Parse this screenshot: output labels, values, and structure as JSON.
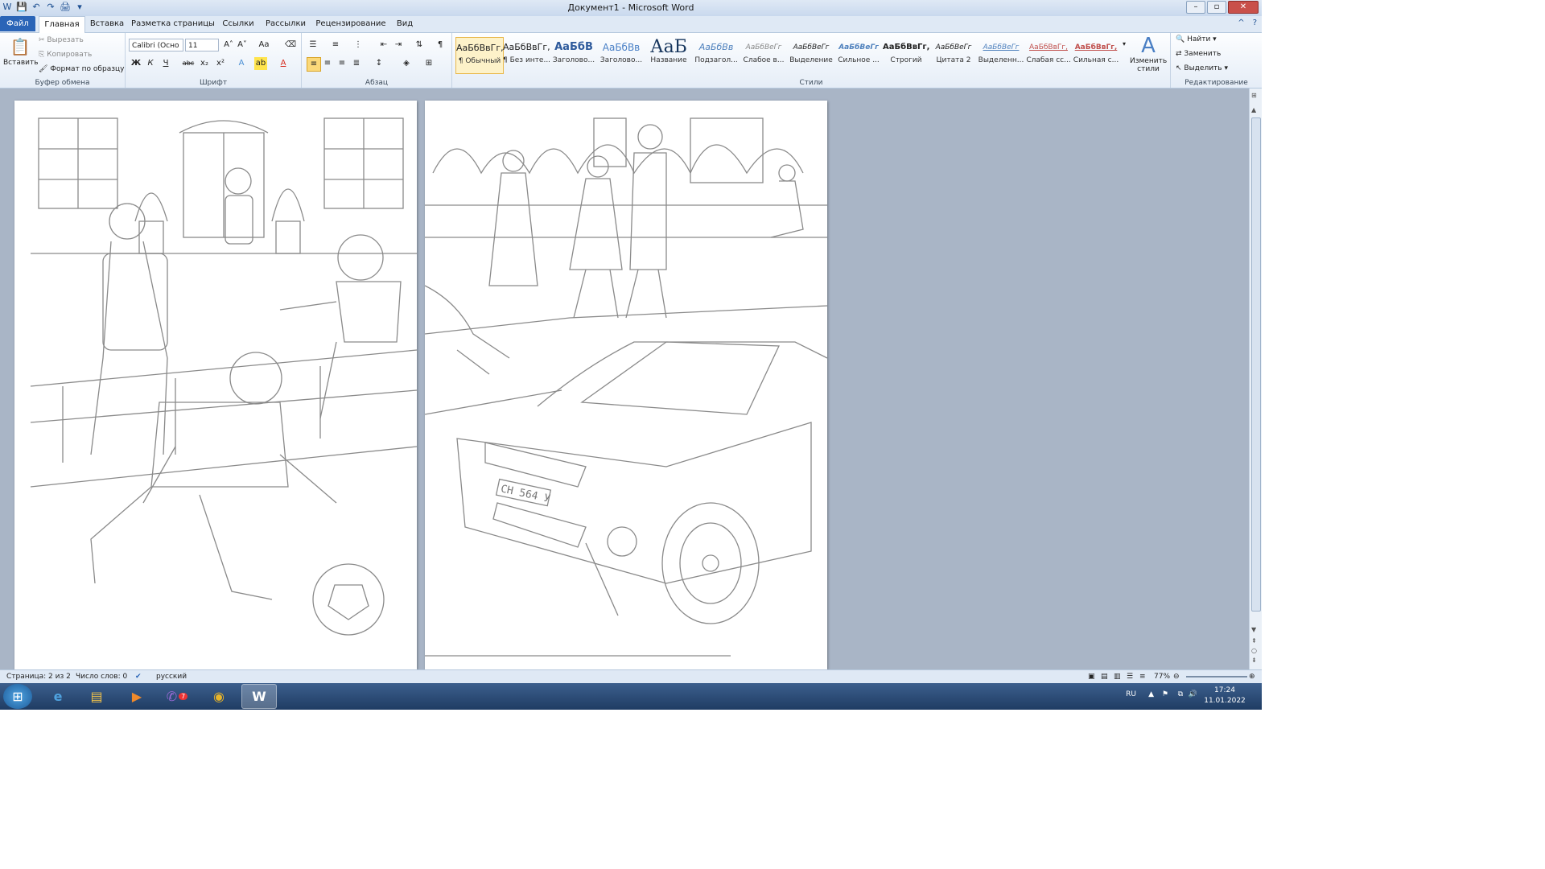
{
  "window": {
    "title": "Документ1 - Microsoft Word"
  },
  "tabs": [
    {
      "label": "Файл"
    },
    {
      "label": "Главная"
    },
    {
      "label": "Вставка"
    },
    {
      "label": "Разметка страницы"
    },
    {
      "label": "Ссылки"
    },
    {
      "label": "Рассылки"
    },
    {
      "label": "Рецензирование"
    },
    {
      "label": "Вид"
    }
  ],
  "clipboard": {
    "paste": "Вставить",
    "cut": "Вырезать",
    "copy": "Копировать",
    "format_painter": "Формат по образцу",
    "group": "Буфер обмена"
  },
  "font": {
    "name": "Calibri (Осно",
    "size": "11",
    "group": "Шрифт",
    "bold": "Ж",
    "italic": "К",
    "underline": "Ч",
    "strike": "abc",
    "sub": "x₂",
    "sup": "x²"
  },
  "paragraph": {
    "group": "Абзац"
  },
  "styles": {
    "group": "Стили",
    "items": [
      {
        "sample": "АаБбВвГг,",
        "name": "¶ Обычный"
      },
      {
        "sample": "АаБбВвГг,",
        "name": "¶ Без инте..."
      },
      {
        "sample": "АаБбВ",
        "name": "Заголово..."
      },
      {
        "sample": "АаБбВв",
        "name": "Заголово..."
      },
      {
        "sample": "АаБ",
        "name": "Название"
      },
      {
        "sample": "АаБбВв",
        "name": "Подзагол..."
      },
      {
        "sample": "АаБбВеГг",
        "name": "Слабое в..."
      },
      {
        "sample": "АаБбВеГг",
        "name": "Выделение"
      },
      {
        "sample": "АаБбВеГг",
        "name": "Сильное ..."
      },
      {
        "sample": "АаБбВвГг,",
        "name": "Строгий"
      },
      {
        "sample": "АаБбВеГг",
        "name": "Цитата 2"
      },
      {
        "sample": "АаБбВеГг",
        "name": "Выделенн..."
      },
      {
        "sample": "АаБбВвГг,",
        "name": "Слабая сс..."
      },
      {
        "sample": "АаБбВвГг,",
        "name": "Сильная с..."
      }
    ],
    "change": "Изменить стили"
  },
  "editing": {
    "find": "Найти",
    "replace": "Заменить",
    "select": "Выделить",
    "group": "Редактирование"
  },
  "status": {
    "page": "Страница: 2 из 2",
    "words": "Число слов: 0",
    "lang": "русский",
    "zoom": "77%"
  },
  "page2": {
    "plate": "СН 564 У"
  },
  "tray": {
    "lang": "RU",
    "time": "17:24",
    "date": "11.01.2022"
  },
  "taskbar": {
    "viber_badge": "7"
  },
  "colors": {
    "file_tab": "#2a64b7",
    "ribbon_bg": "#e5edf7",
    "doc_bg": "#a9b5c6",
    "taskbar": "#1f3c63"
  }
}
